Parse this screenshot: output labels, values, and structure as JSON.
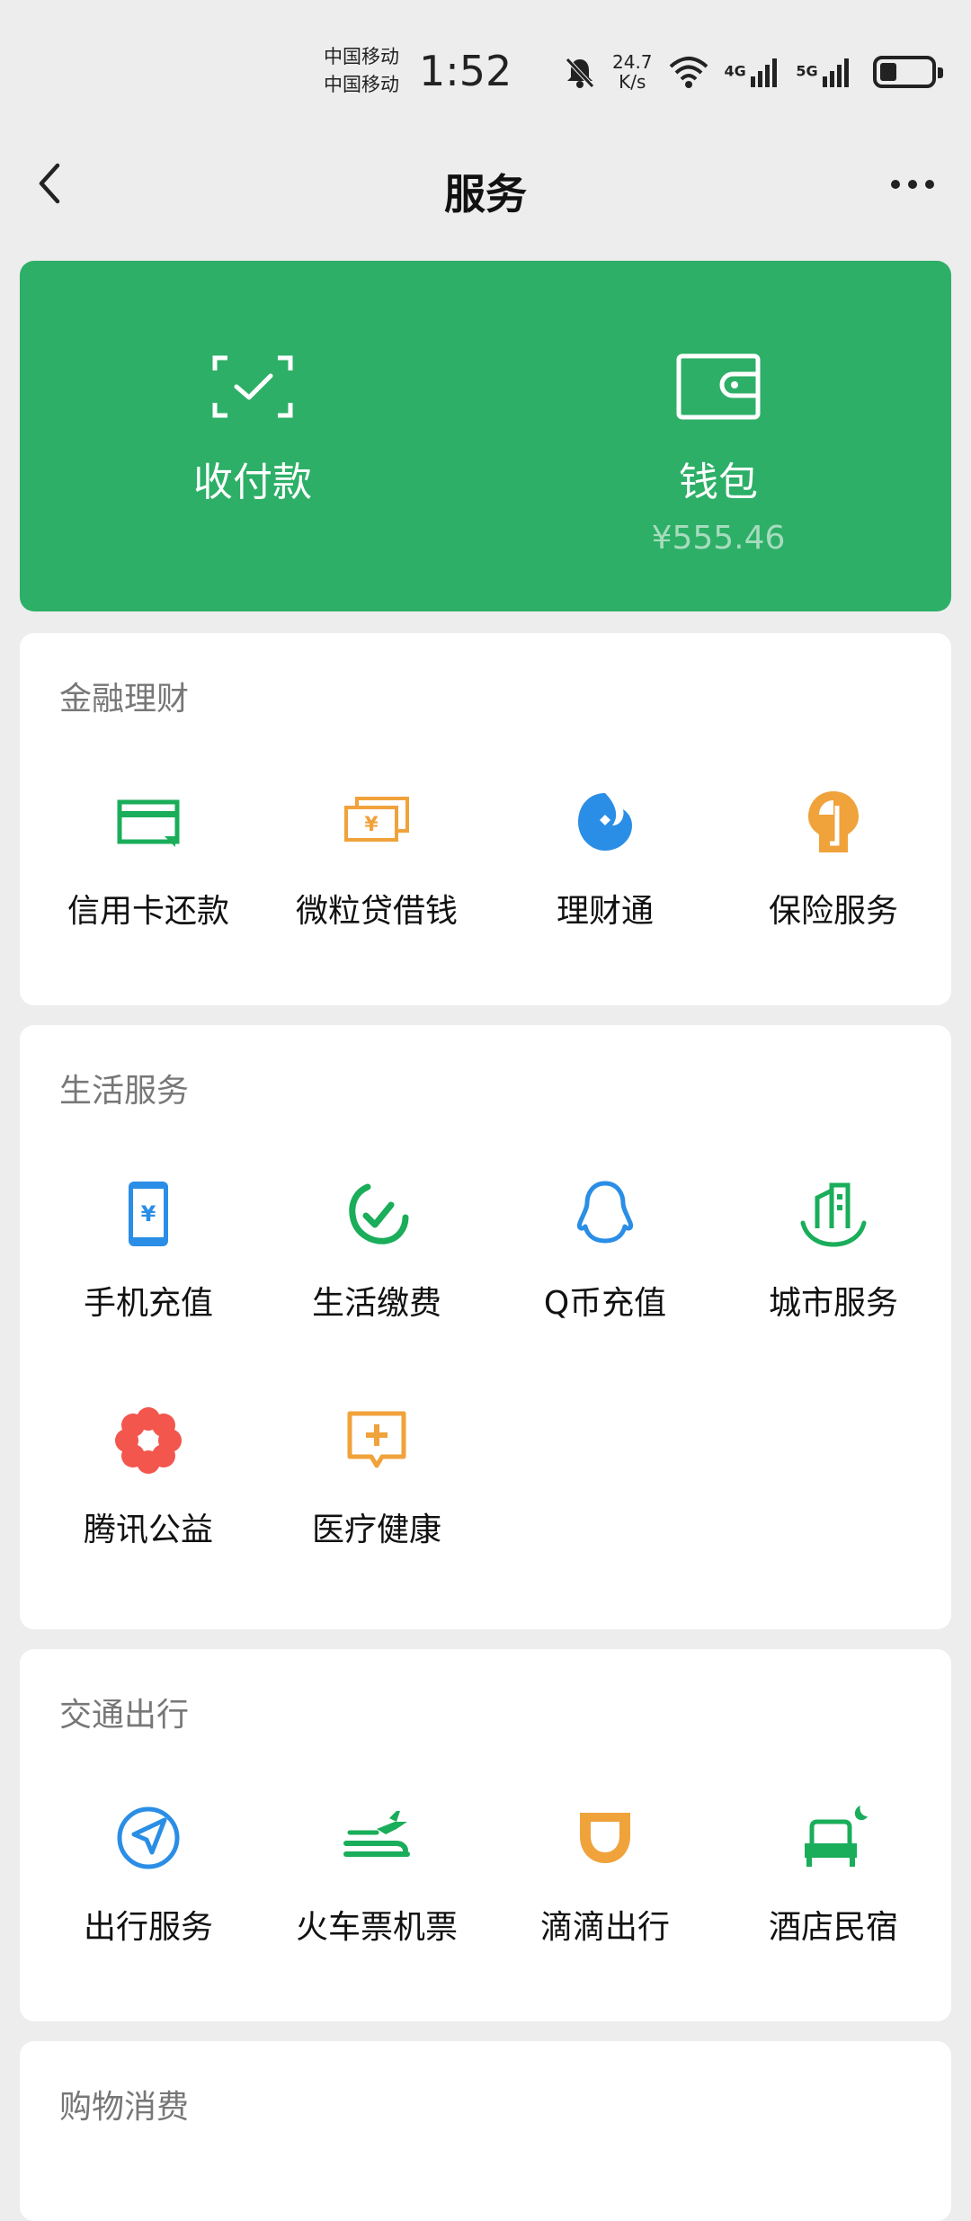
{
  "status_bar": {
    "carrier_1": "中国移动",
    "carrier_2": "中国移动",
    "time": "1:52",
    "speed_value": "24.7",
    "speed_unit": "K/s",
    "net_1": "4G",
    "net_2": "5G"
  },
  "nav": {
    "title": "服务"
  },
  "top_card": {
    "pay_label": "收付款",
    "wallet_label": "钱包",
    "wallet_balance": "¥555.46"
  },
  "sections": {
    "finance": {
      "title": "金融理财",
      "items": [
        {
          "label": "信用卡还款",
          "icon": "credit-card-icon",
          "color": "#1aad5a"
        },
        {
          "label": "微粒贷借钱",
          "icon": "money-notes-icon",
          "color": "#f0a23b"
        },
        {
          "label": "理财通",
          "icon": "wealth-icon",
          "color": "#2a8ee6"
        },
        {
          "label": "保险服务",
          "icon": "insurance-icon",
          "color": "#f0a23b"
        }
      ]
    },
    "life": {
      "title": "生活服务",
      "items": [
        {
          "label": "手机充值",
          "icon": "phone-topup-icon",
          "color": "#2a8ee6"
        },
        {
          "label": "生活缴费",
          "icon": "bill-payment-icon",
          "color": "#1aad5a"
        },
        {
          "label": "Q币充值",
          "icon": "penguin-icon",
          "color": "#2a8ee6"
        },
        {
          "label": "城市服务",
          "icon": "city-icon",
          "color": "#1aad5a"
        },
        {
          "label": "腾讯公益",
          "icon": "charity-flower-icon",
          "color": "#f2564d"
        },
        {
          "label": "医疗健康",
          "icon": "medical-icon",
          "color": "#f0a23b"
        }
      ]
    },
    "travel": {
      "title": "交通出行",
      "items": [
        {
          "label": "出行服务",
          "icon": "navigation-icon",
          "color": "#2a8ee6"
        },
        {
          "label": "火车票机票",
          "icon": "train-plane-icon",
          "color": "#1aad5a"
        },
        {
          "label": "滴滴出行",
          "icon": "didi-icon",
          "color": "#f0a23b"
        },
        {
          "label": "酒店民宿",
          "icon": "hotel-bed-icon",
          "color": "#1aad5a"
        }
      ]
    },
    "shopping": {
      "title": "购物消费"
    }
  }
}
